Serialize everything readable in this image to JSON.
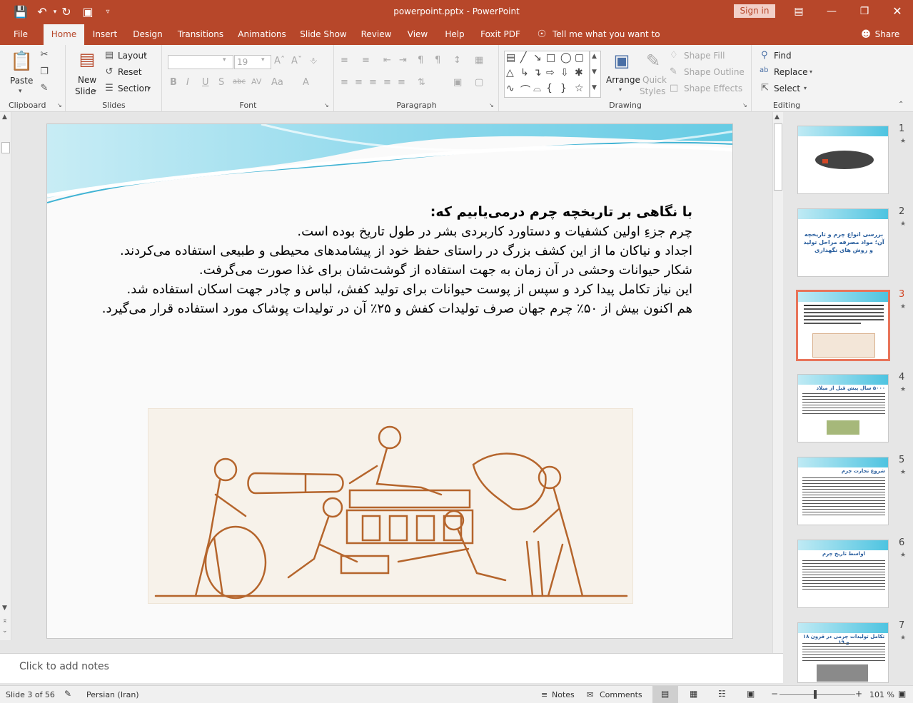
{
  "window": {
    "title": "powerpoint.pptx - PowerPoint",
    "sign_in": "Sign in"
  },
  "tabs": [
    "File",
    "Home",
    "Insert",
    "Design",
    "Transitions",
    "Animations",
    "Slide Show",
    "Review",
    "View",
    "Help",
    "Foxit PDF"
  ],
  "tell_me": "Tell me what you want to do",
  "share": "Share",
  "ribbon": {
    "clipboard": {
      "label": "Clipboard",
      "paste": "Paste"
    },
    "slides": {
      "label": "Slides",
      "new_slide_1": "New",
      "new_slide_2": "Slide",
      "layout": "Layout",
      "reset": "Reset",
      "section": "Section"
    },
    "font": {
      "label": "Font",
      "size": "19"
    },
    "paragraph": {
      "label": "Paragraph"
    },
    "drawing": {
      "label": "Drawing",
      "arrange": "Arrange",
      "quick_styles_1": "Quick",
      "quick_styles_2": "Styles",
      "shape_fill": "Shape Fill",
      "shape_outline": "Shape Outline",
      "shape_effects": "Shape Effects"
    },
    "editing": {
      "label": "Editing",
      "find": "Find",
      "replace": "Replace",
      "select": "Select"
    }
  },
  "slide": {
    "heading": "با نگاهی بر تاریخچه چرم درمی‌یابیم که:",
    "paragraphs": [
      "چرم جزءِ اولین کشفیات و دستاورد کاربردی بشر در طول تاریخ بوده است.",
      "اجداد و نیاکان ما از این کشف بزرگ در راستای حفظ خود از پیشامدهای محیطی و طبیعی استفاده می‌کردند.",
      "شکار حیوانات وحشی در آن زمان به جهت استفاده از گوشت‌شان برای غذا صورت می‌گرفت.",
      "این نیاز تکامل پیدا کرد و سپس از پوست حیوانات برای تولید کفش، لباس و چادر جهت اسکان استفاده شد.",
      "هم اکنون بیش از ۵۰٪ چرم جهان صرف تولیدات کفش و ۲۵٪ آن در تولیدات پوشاک مورد استفاده قرار می‌گیرد."
    ]
  },
  "notes_placeholder": "Click to add notes",
  "thumbnails": [
    "1",
    "2",
    "3",
    "4",
    "5",
    "6",
    "7"
  ],
  "selected_slide": "3",
  "thumb_titles": {
    "t2": "بررسی انواع چرم و تاریخچه آن؛ مواد مصرفه مراحل تولید و روش های نگهداری",
    "t4": "۵۰۰۰ سال پیش قبل از میلاد",
    "t5": "شروع تجارت چرم",
    "t6": "اواسط تاریخ چرم",
    "t7": "تکامل تولیدات چرمی در قرون ۱۸ و ۱۹"
  },
  "status": {
    "slide_info": "Slide 3 of 56",
    "language": "Persian (Iran)",
    "notes": "Notes",
    "comments": "Comments",
    "zoom": "101 %"
  },
  "colors": {
    "accent": "#b7472a",
    "selected_thumb": "#e8745a"
  }
}
